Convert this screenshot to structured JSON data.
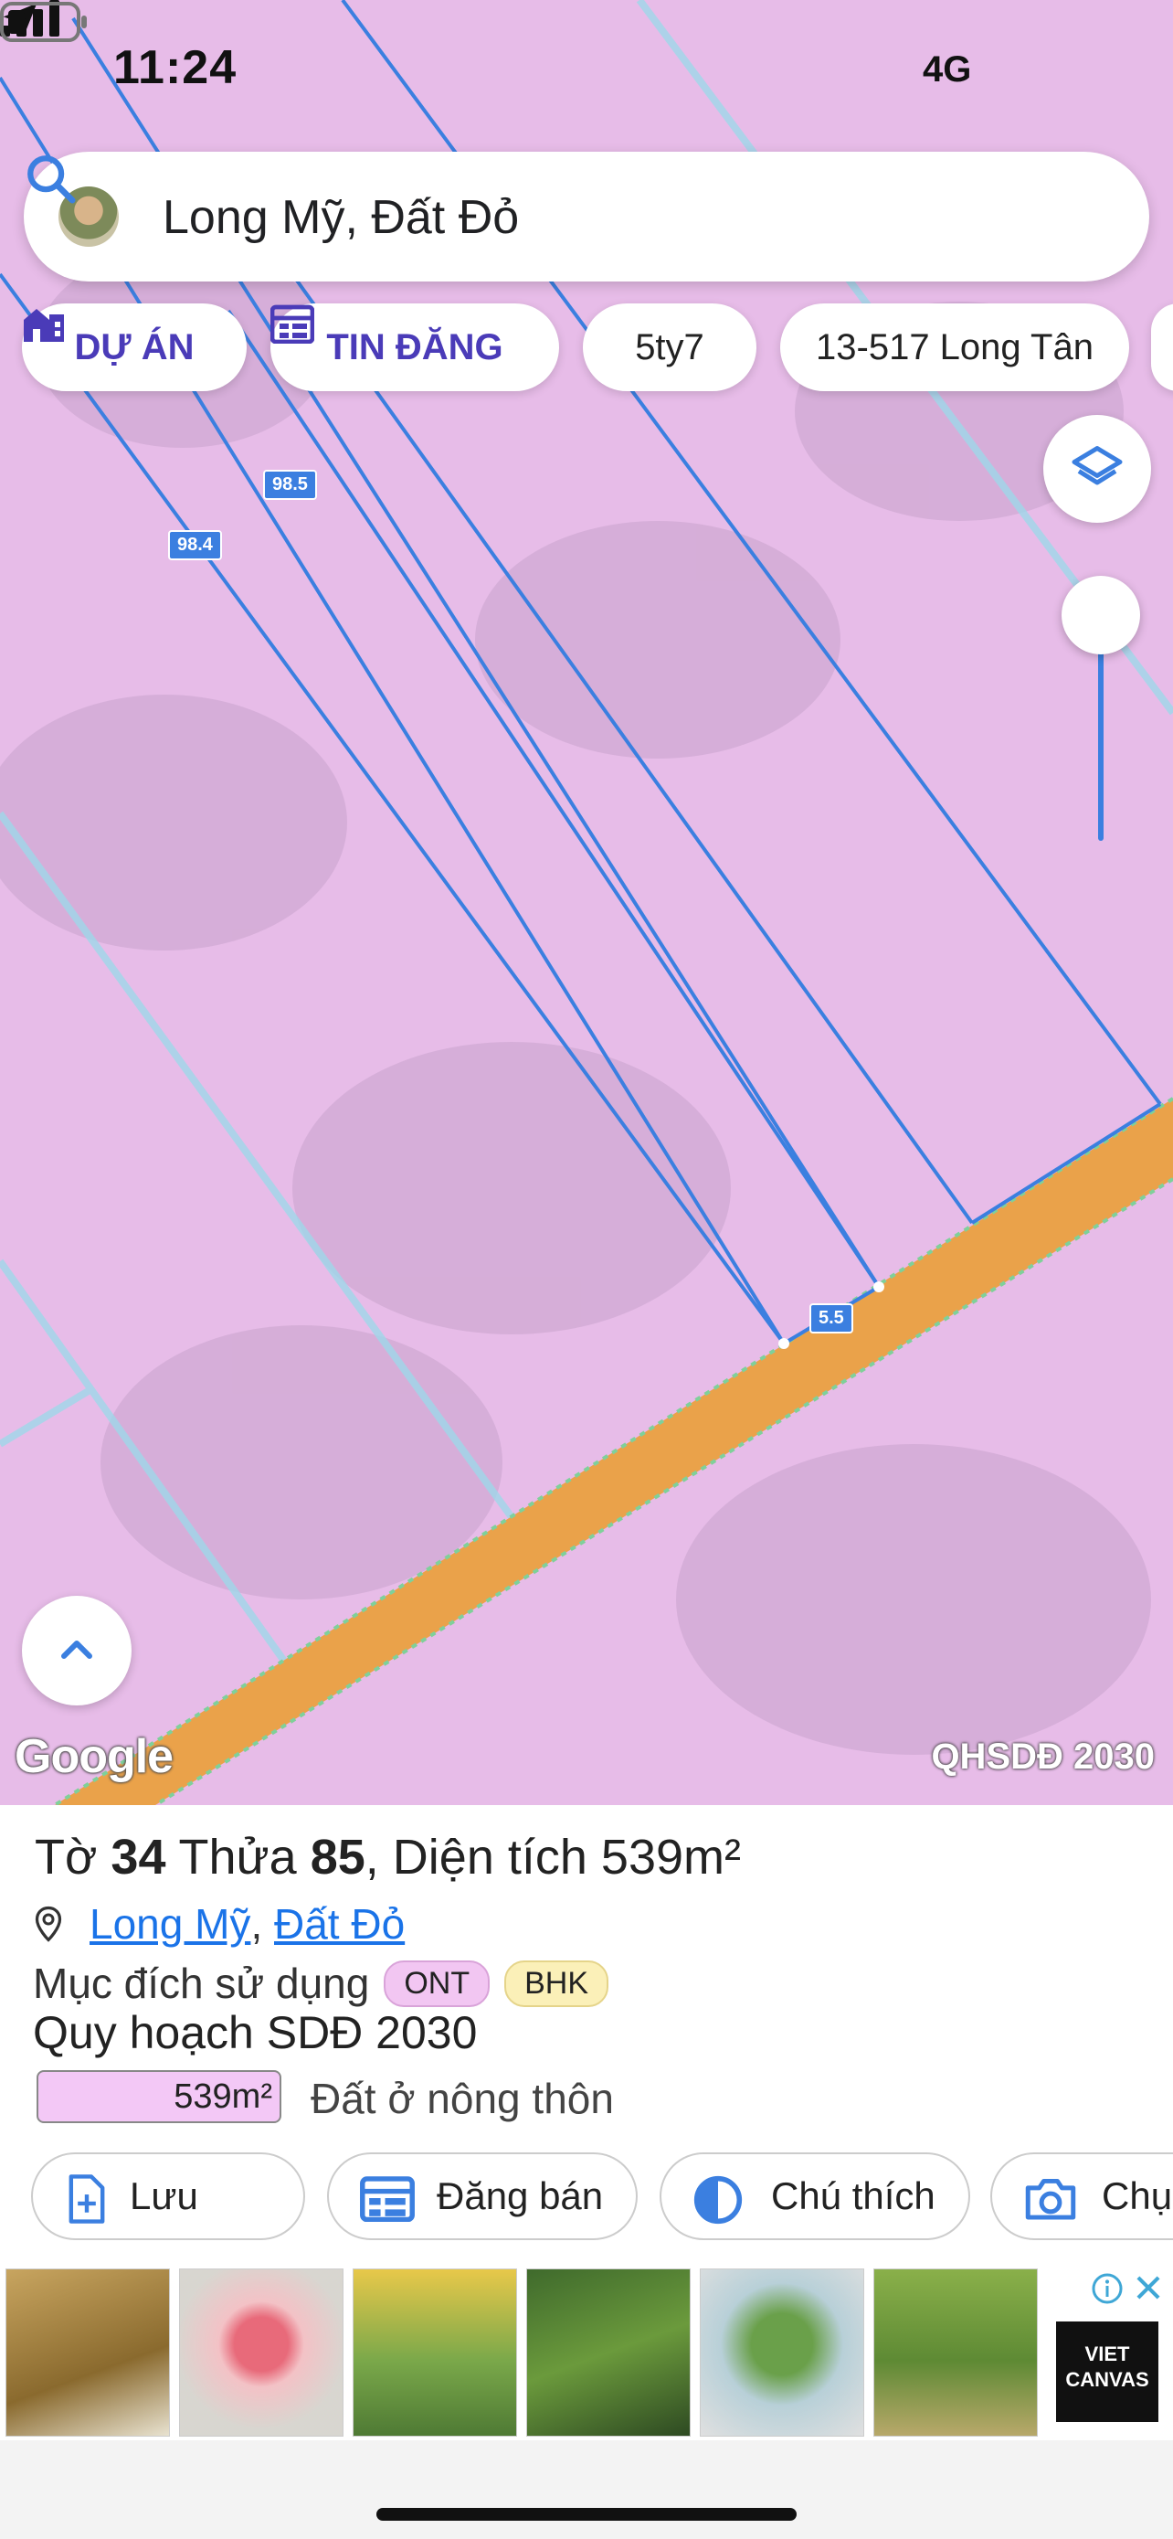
{
  "status_bar": {
    "time": "11:24",
    "network": "4G"
  },
  "search": {
    "query": "Long Mỹ, Đất Đỏ"
  },
  "chips": [
    {
      "label": "DỰ ÁN",
      "icon": "building-icon"
    },
    {
      "label": "TIN ĐĂNG",
      "icon": "listing-icon"
    },
    {
      "label": "5ty7"
    },
    {
      "label": "13-517 Long Tân"
    }
  ],
  "map": {
    "edge_labels": [
      "98.5",
      "98.4",
      "5.5"
    ],
    "watermark": "Google",
    "layer_label": "QHSDĐ 2030",
    "colors": {
      "land": "#e7bce8",
      "road": "#eaa24a",
      "boundary": "#3b7fe0"
    }
  },
  "parcel": {
    "title_prefix_1": "Tờ ",
    "sheet": "34",
    "title_prefix_2": " Thửa ",
    "plot": "85",
    "title_suffix": ", Diện tích 539m²",
    "location": [
      "Long Mỹ",
      "Đất Đỏ"
    ],
    "purpose_label": "Mục đích sử dụng",
    "purpose_tags": [
      "ONT",
      "BHK"
    ],
    "plan_title": "Quy hoạch SDĐ 2030",
    "plan_area": "539m²",
    "plan_desc": "Đất ở nông thôn"
  },
  "actions": [
    {
      "label": "Lưu",
      "icon": "save-icon"
    },
    {
      "label": "Đăng bán",
      "icon": "post-icon"
    },
    {
      "label": "Chú thích",
      "icon": "legend-icon"
    },
    {
      "label": "Chụp",
      "icon": "camera-icon"
    }
  ],
  "ad": {
    "brand_line1": "VIET",
    "brand_line2": "CANVAS"
  }
}
